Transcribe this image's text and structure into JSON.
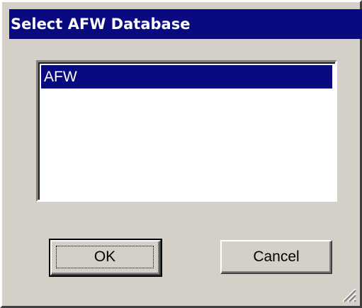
{
  "window": {
    "title": "Select AFW Database"
  },
  "list": {
    "items": [
      {
        "label": "AFW",
        "selected": true
      }
    ]
  },
  "buttons": {
    "ok_label": "OK",
    "cancel_label": "Cancel"
  },
  "colors": {
    "titlebar": "#0a0a80",
    "face": "#d4d0c8",
    "selection": "#0a0a80"
  },
  "icons": {
    "resize": "resize-grip-icon"
  }
}
